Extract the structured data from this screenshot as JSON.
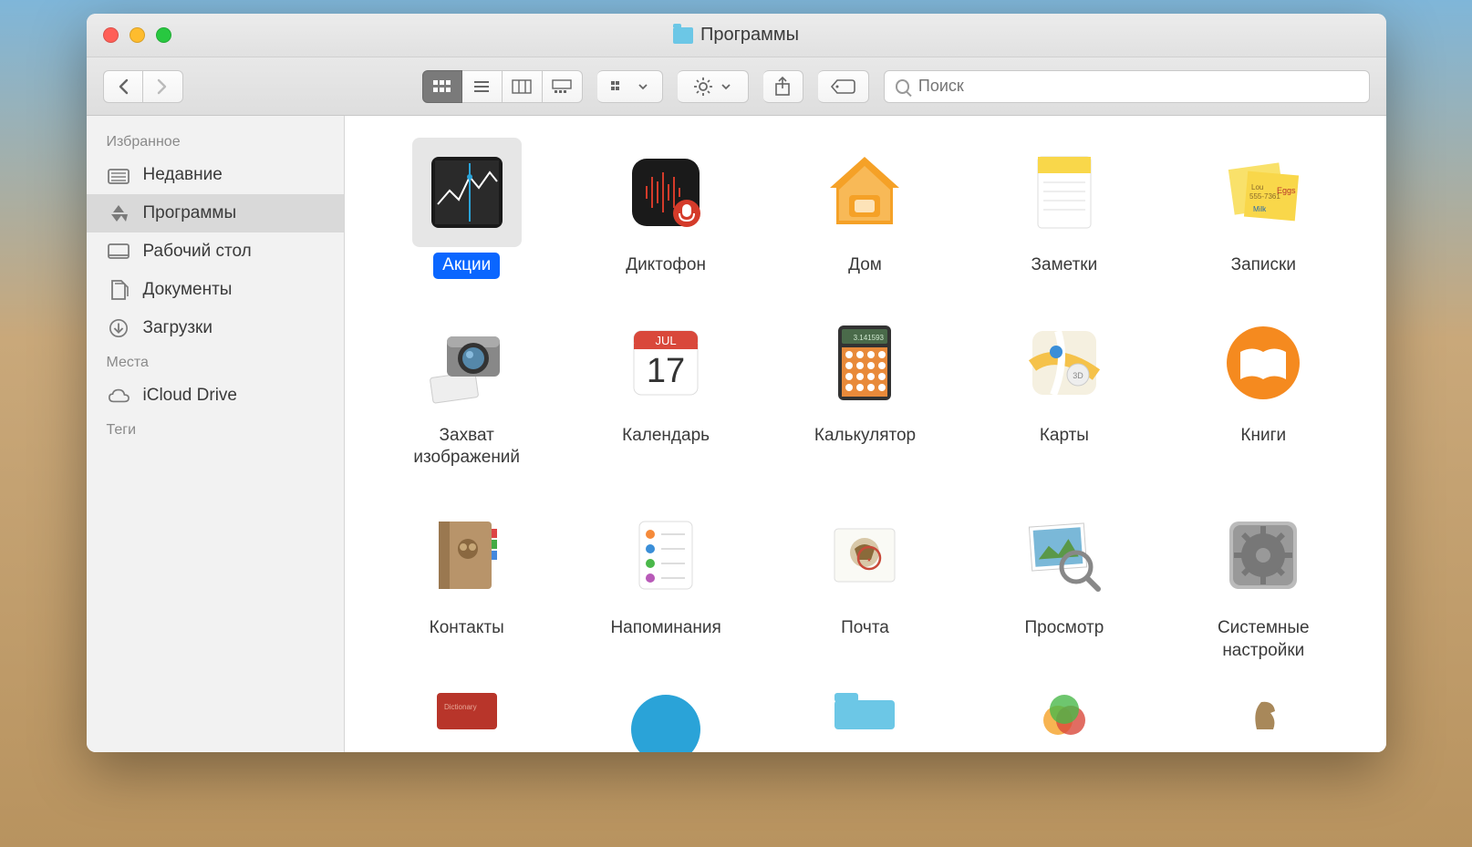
{
  "window": {
    "title": "Программы"
  },
  "toolbar": {
    "search_placeholder": "Поиск"
  },
  "sidebar": {
    "sections": [
      {
        "title": "Избранное",
        "items": [
          {
            "label": "Недавние",
            "icon": "recents",
            "selected": false
          },
          {
            "label": "Программы",
            "icon": "apps",
            "selected": true
          },
          {
            "label": "Рабочий стол",
            "icon": "desktop",
            "selected": false
          },
          {
            "label": "Документы",
            "icon": "documents",
            "selected": false
          },
          {
            "label": "Загрузки",
            "icon": "downloads",
            "selected": false
          }
        ]
      },
      {
        "title": "Места",
        "items": [
          {
            "label": "iCloud Drive",
            "icon": "icloud",
            "selected": false
          }
        ]
      },
      {
        "title": "Теги",
        "items": []
      }
    ]
  },
  "apps": [
    {
      "label": "Акции",
      "icon": "stocks",
      "selected": true
    },
    {
      "label": "Диктофон",
      "icon": "voicememos",
      "selected": false
    },
    {
      "label": "Дом",
      "icon": "home",
      "selected": false
    },
    {
      "label": "Заметки",
      "icon": "notes",
      "selected": false
    },
    {
      "label": "Записки",
      "icon": "stickies",
      "selected": false
    },
    {
      "label": "Захват изображений",
      "icon": "imagecapture",
      "selected": false
    },
    {
      "label": "Календарь",
      "icon": "calendar",
      "selected": false,
      "meta": {
        "month": "JUL",
        "day": "17"
      }
    },
    {
      "label": "Калькулятор",
      "icon": "calculator",
      "selected": false,
      "meta": {
        "display": "3.141593"
      }
    },
    {
      "label": "Карты",
      "icon": "maps",
      "selected": false
    },
    {
      "label": "Книги",
      "icon": "books",
      "selected": false
    },
    {
      "label": "Контакты",
      "icon": "contacts",
      "selected": false
    },
    {
      "label": "Напоминания",
      "icon": "reminders",
      "selected": false
    },
    {
      "label": "Почта",
      "icon": "mail",
      "selected": false
    },
    {
      "label": "Просмотр",
      "icon": "preview",
      "selected": false
    },
    {
      "label": "Системные настройки",
      "icon": "systemprefs",
      "selected": false
    },
    {
      "label": "",
      "icon": "dictionary",
      "selected": false,
      "partial": true
    },
    {
      "label": "",
      "icon": "blueapp",
      "selected": false,
      "partial": true
    },
    {
      "label": "",
      "icon": "folder",
      "selected": false,
      "partial": true
    },
    {
      "label": "",
      "icon": "photos",
      "selected": false,
      "partial": true
    },
    {
      "label": "",
      "icon": "chess",
      "selected": false,
      "partial": true
    }
  ]
}
